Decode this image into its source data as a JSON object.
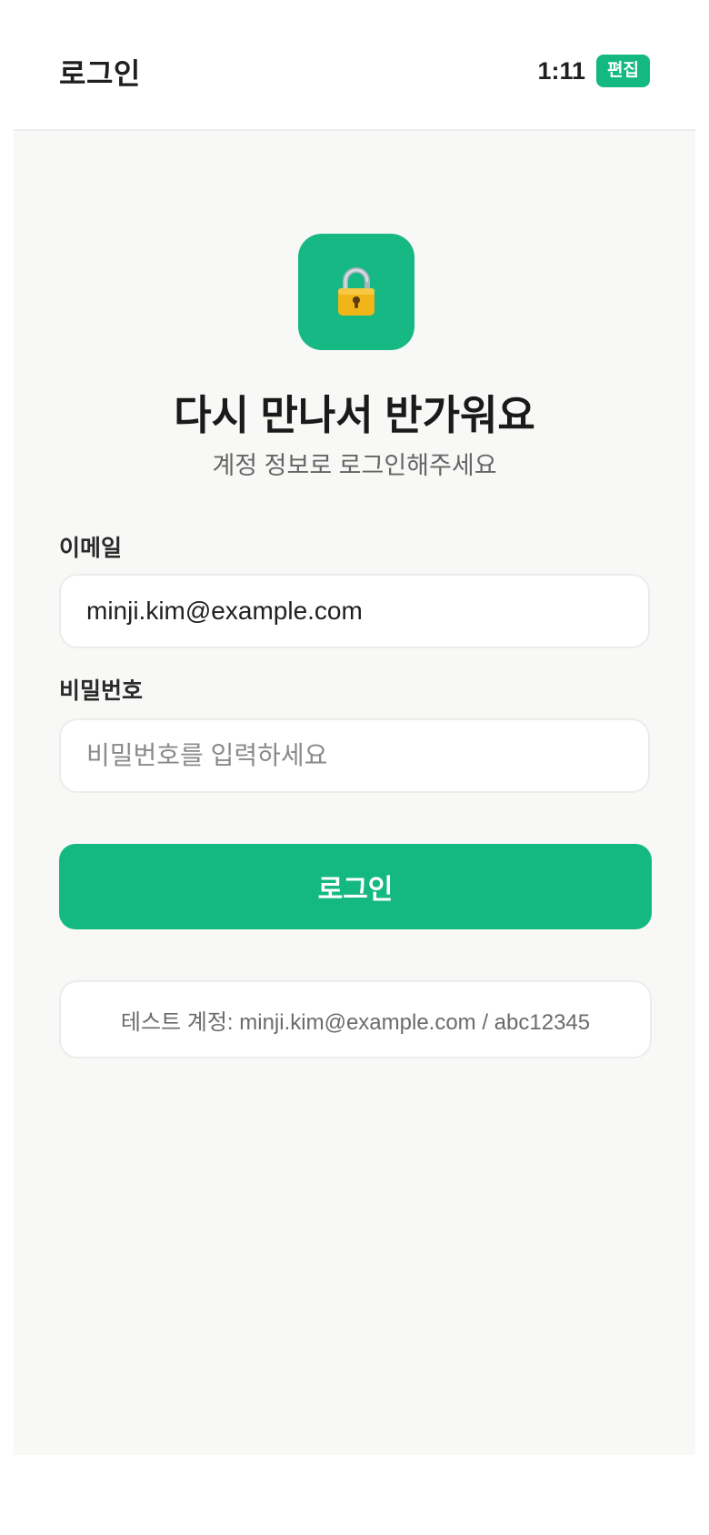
{
  "header": {
    "title": "로그인",
    "clock": "1:11",
    "edit_badge": "편집"
  },
  "hero": {
    "icon": "lock-icon",
    "title": "다시 만나서 반가워요",
    "subtitle": "계정 정보로 로그인해주세요"
  },
  "form": {
    "email_label": "이메일",
    "email_value": "minji.kim@example.com",
    "password_label": "비밀번호",
    "password_placeholder": "비밀번호를 입력하세요",
    "password_value": "",
    "submit_label": "로그인"
  },
  "hint": {
    "text": "테스트 계정: minji.kim@example.com / abc12345"
  },
  "colors": {
    "accent": "#13b981",
    "background": "#f8f8f7"
  }
}
